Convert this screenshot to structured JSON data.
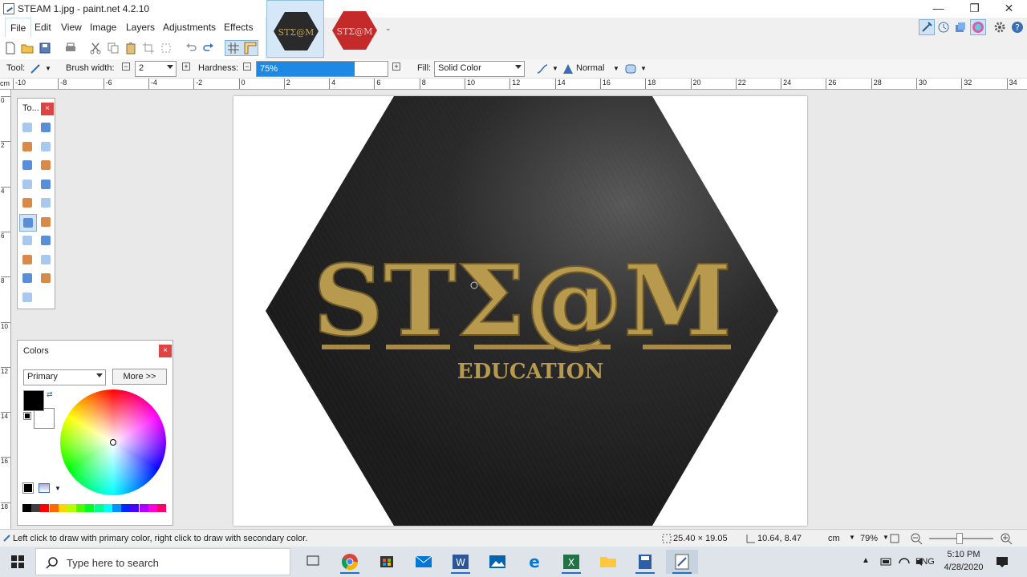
{
  "window": {
    "title": "STEAM 1.jpg - paint.net 4.2.10"
  },
  "menu": [
    "File",
    "Edit",
    "View",
    "Image",
    "Layers",
    "Adjustments",
    "Effects"
  ],
  "image_tabs": [
    {
      "thumb_text": "STΣ@M",
      "color": "#2a2a2a"
    },
    {
      "thumb_text": "STΣ@M",
      "color": "#c52a2a"
    }
  ],
  "options": {
    "tool_label": "Tool:",
    "brush_width_label": "Brush width:",
    "brush_width_value": "2",
    "hardness_label": "Hardness:",
    "hardness_value": "75%",
    "hardness_fraction": 0.75,
    "fill_label": "Fill:",
    "fill_value": "Solid Color",
    "blend_value": "Normal"
  },
  "ruler": {
    "unit": "cm",
    "top_ticks": [
      "-10",
      "-8",
      "-6",
      "-4",
      "-2",
      "0",
      "2",
      "4",
      "6",
      "8",
      "10",
      "12",
      "14",
      "16",
      "18",
      "20",
      "22",
      "24",
      "26",
      "28",
      "30",
      "32",
      "34"
    ],
    "left_ticks": [
      "0",
      "2",
      "4",
      "6",
      "8",
      "10",
      "12",
      "14",
      "16",
      "18"
    ]
  },
  "tools_panel": {
    "title": "To...",
    "close": "×"
  },
  "colors_panel": {
    "title": "Colors",
    "close": "×",
    "mode": "Primary",
    "more_button": "More >>",
    "primary_color": "#000000",
    "secondary_color": "#ffffff",
    "palette": [
      "#000000",
      "#404040",
      "#ff0000",
      "#ff6a00",
      "#ffd800",
      "#b6ff00",
      "#4cff00",
      "#00ff21",
      "#00ff90",
      "#00ffff",
      "#0094ff",
      "#0026ff",
      "#4800ff",
      "#b200ff",
      "#ff00dc",
      "#ff006e"
    ]
  },
  "canvas_image": {
    "main_text": "STΣ@M",
    "sub_text": "EDUCATION",
    "base_color": "#262626",
    "text_color": "#b89a4f"
  },
  "status": {
    "hint": "Left click to draw with primary color, right click to draw with secondary color.",
    "selection_size": "25.40 × 19.05",
    "cursor_position": "10.64, 8.47",
    "unit": "cm",
    "zoom": "79%"
  },
  "taskbar": {
    "search_placeholder": "Type here to search",
    "lang": "ENG",
    "time": "5:10 PM",
    "date": "4/28/2020"
  }
}
